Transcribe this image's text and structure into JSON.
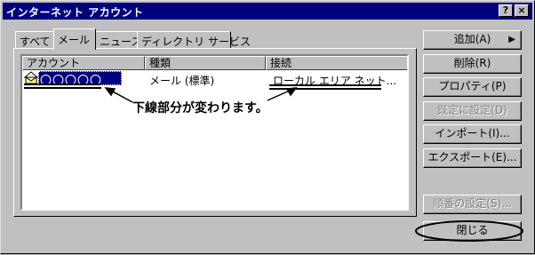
{
  "window": {
    "title": "インターネット アカウント",
    "help_button": "?",
    "close_button": "×"
  },
  "tabs": [
    {
      "label": "すべて",
      "active": false
    },
    {
      "label": "メール",
      "active": true
    },
    {
      "label": "ニュース",
      "active": false
    },
    {
      "label": "ディレクトリ サービス",
      "active": false
    }
  ],
  "list": {
    "columns": [
      "アカウント",
      "種類",
      "接続"
    ],
    "rows": [
      {
        "account": "〇〇〇〇〇",
        "type": "メール (標準)",
        "connection": "ローカル エリア ネット..."
      }
    ]
  },
  "annotation": "下線部分が変わります。",
  "buttons": {
    "add": "追加(A)",
    "delete": "削除(R)",
    "properties": "プロパティ(P)",
    "set_default": "既定に設定(D)",
    "import": "インポート(I)...",
    "export": "エクスポート(E)...",
    "set_order": "順番の設定(S)...",
    "close": "閉じる"
  }
}
